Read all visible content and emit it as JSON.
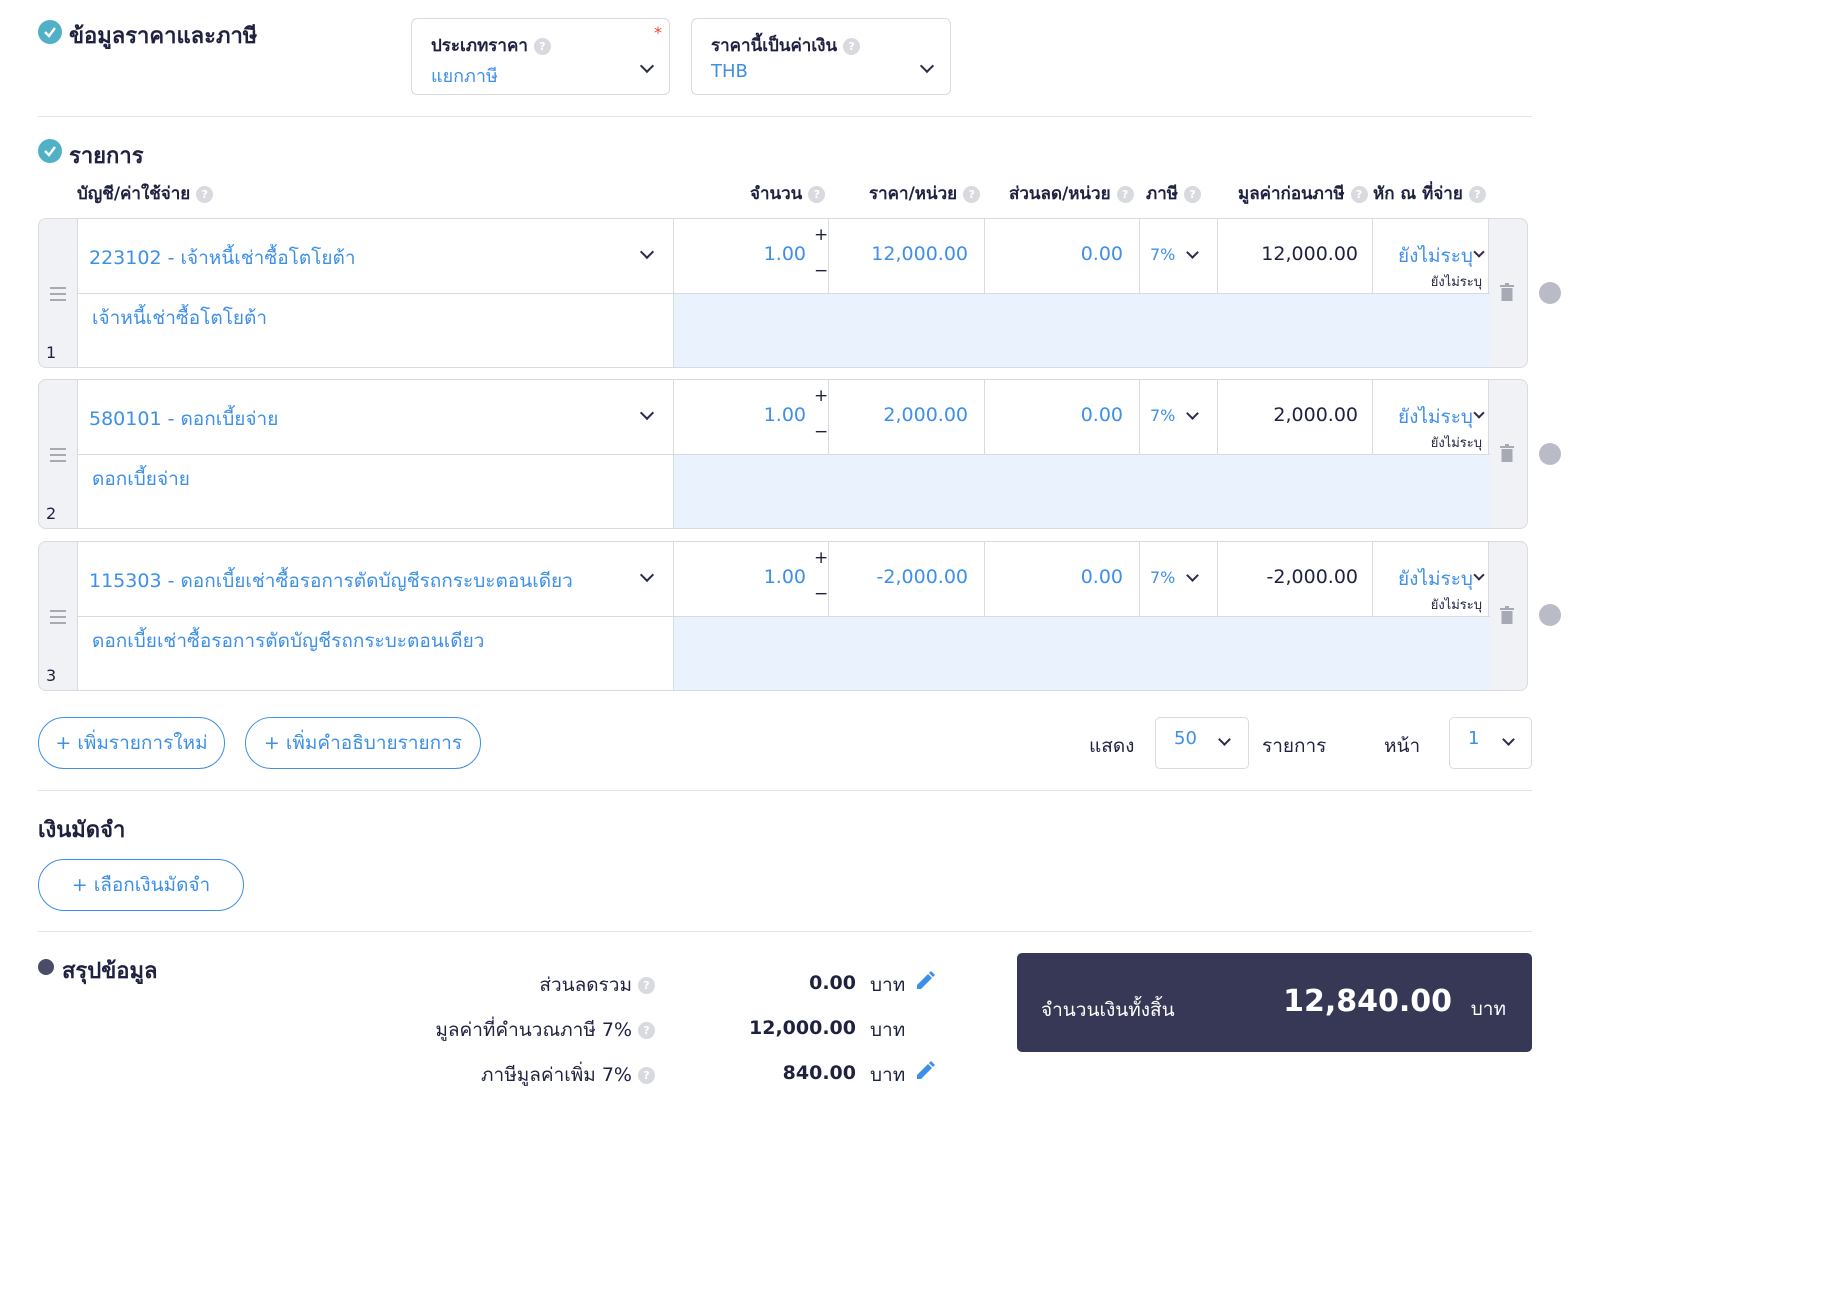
{
  "price_tax": {
    "title": "ข้อมูลราคาและภาษี",
    "price_type": {
      "label": "ประเภทราคา",
      "value": "แยกภาษี",
      "required": "*"
    },
    "currency": {
      "label": "ราคานี้เป็นค่าเงิน",
      "value": "THB"
    }
  },
  "items": {
    "title": "รายการ",
    "columns": {
      "account": "บัญชี/ค่าใช้จ่าย",
      "qty": "จำนวน",
      "unit_price": "ราคา/หน่วย",
      "discount": "ส่วนลด/หน่วย",
      "tax": "ภาษี",
      "pre_tax": "มูลค่าก่อนภาษี",
      "wht": "หัก ณ ที่จ่าย"
    },
    "rows": [
      {
        "num": "1",
        "account": "223102 - เจ้าหนี้เช่าซื้อโตโยต้า",
        "description": "เจ้าหนี้เช่าซื้อโตโยต้า",
        "qty": "1.00",
        "unit_price": "12,000.00",
        "discount": "0.00",
        "tax": "7%",
        "pre_tax": "12,000.00",
        "wht": "ยังไม่ระบุ",
        "wht_sub": "ยังไม่ระบุ"
      },
      {
        "num": "2",
        "account": "580101 - ดอกเบี้ยจ่าย",
        "description": "ดอกเบี้ยจ่าย",
        "qty": "1.00",
        "unit_price": "2,000.00",
        "discount": "0.00",
        "tax": "7%",
        "pre_tax": "2,000.00",
        "wht": "ยังไม่ระบุ",
        "wht_sub": "ยังไม่ระบุ"
      },
      {
        "num": "3",
        "account": "115303 - ดอกเบี้ยเช่าซื้อรอการตัดบัญชีรถกระบะตอนเดียว",
        "description": "ดอกเบี้ยเช่าซื้อรอการตัดบัญชีรถกระบะตอนเดียว",
        "qty": "1.00",
        "unit_price": "-2,000.00",
        "discount": "0.00",
        "tax": "7%",
        "pre_tax": "-2,000.00",
        "wht": "ยังไม่ระบุ",
        "wht_sub": "ยังไม่ระบุ"
      }
    ],
    "add_item": "+ เพิ่มรายการใหม่",
    "add_description": "+ เพิ่มคำอธิบายรายการ",
    "pager": {
      "show_label": "แสดง",
      "per_page": "50",
      "items_label": "รายการ",
      "page_label": "หน้า",
      "page": "1"
    }
  },
  "deposit": {
    "title": "เงินมัดจำ",
    "select_button": "+ เลือกเงินมัดจำ"
  },
  "summary": {
    "title": "สรุปข้อมูล",
    "lines": [
      {
        "label": "ส่วนลดรวม",
        "value": "0.00",
        "unit": "บาท"
      },
      {
        "label": "มูลค่าที่คำนวณภาษี 7%",
        "value": "12,000.00",
        "unit": "บาท"
      },
      {
        "label": "ภาษีมูลค่าเพิ่ม 7%",
        "value": "840.00",
        "unit": "บาท"
      }
    ],
    "total_label": "จำนวนเงินทั้งสิ้น",
    "total_value": "12,840.00",
    "total_unit": "บาท"
  },
  "colors": {
    "accent": "#3d8fe8",
    "check": "#4fb0c6",
    "dark_panel": "#363855",
    "desc_bg": "#eaf3fd"
  }
}
